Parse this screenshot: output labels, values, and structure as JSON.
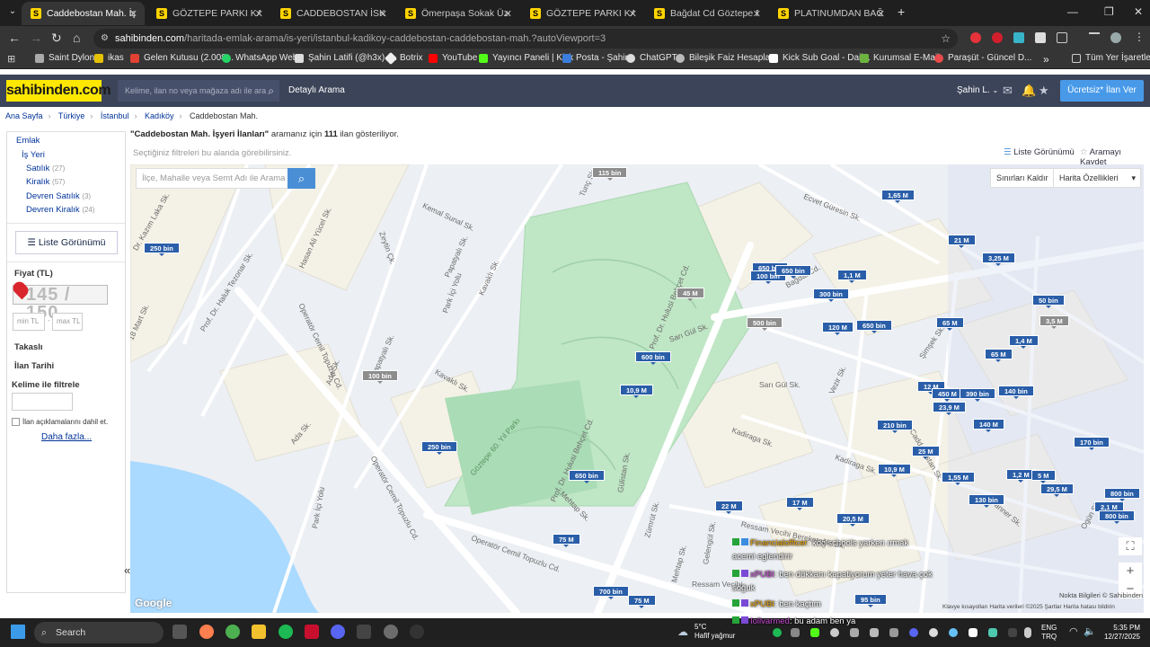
{
  "browser": {
    "tabs": [
      {
        "title": "Caddebostan Mah. İşyeri İl",
        "active": true
      },
      {
        "title": "GÖZTEPE PARKI KARŞISINI"
      },
      {
        "title": "CADDEBOSTAN İSKELE SOK"
      },
      {
        "title": "Ömerpaşa Sokak Üzerinde"
      },
      {
        "title": "GÖZTEPE PARKI KARŞISINI"
      },
      {
        "title": "Bağdat Cd Göztepe Parkı"
      },
      {
        "title": "PLATINUMDAN BAĞDAT C"
      }
    ],
    "url_host": "sahibinden.com",
    "url_path": "/haritada-emlak-arama/is-yeri/istanbul-kadikoy-caddebostan-caddebostan-mah.?autoViewport=3",
    "bookmarks": [
      "Saint Dylon",
      "ikas",
      "Gelen Kutusu (2.008...",
      "WhatsApp Web",
      "Şahin Latifi (@h3x) /...",
      "Botrix",
      "YouTube",
      "Yayıncı Paneli | Kick",
      "Posta - Şahin",
      "ChatGPT",
      "Bileşik Faiz Hesapla...",
      "Kick Sub Goal - Dail...",
      "Kurumsal E-Mail",
      "Paraşüt - Güncel D..."
    ],
    "all_bookmarks": "Tüm Yer İşaretleri"
  },
  "site": {
    "logo": "sahibinden.com",
    "search_placeholder": "Kelime, ilan no veya mağaza adı ile ara",
    "detailed_search": "Detaylı Arama",
    "user": "Şahin L.",
    "post_ad": "Ücretsiz* İlan Ver"
  },
  "breadcrumb": [
    "Ana Sayfa",
    "Türkiye",
    "İstanbul",
    "Kadıköy",
    "Caddebostan Mah."
  ],
  "results": {
    "query": "\"Caddebostan Mah. İşyeri İlanları\"",
    "middle": " aramanız için ",
    "count": "111",
    "suffix": " ilan gösteriliyor.",
    "filter_hint": "Seçtiğiniz filtreleri bu alanda görebilirsiniz.",
    "list_view": "Liste Görünümü",
    "save_search": "Aramayı Kaydet"
  },
  "sidebar": {
    "category": "Emlak",
    "subcategory": "İş Yeri",
    "items": [
      {
        "label": "Satılık",
        "count": "(27)"
      },
      {
        "label": "Kiralık",
        "count": "(57)"
      },
      {
        "label": "Devren Satılık",
        "count": "(3)"
      },
      {
        "label": "Devren Kiralık",
        "count": "(24)"
      }
    ],
    "list_view_button": "Liste Görünümü",
    "price_label": "Fiyat (TL)",
    "price_overlay": "145 / 150",
    "min_placeholder": "min TL",
    "max_placeholder": "max TL",
    "swap": "Takaslı",
    "date": "İlan Tarihi",
    "keyword": "Kelime ile filtrele",
    "include_desc": "İlan açıklamalarını dahil et.",
    "more": "Daha fazla..."
  },
  "map": {
    "search_placeholder": "İlçe, Mahalle veya Semt Adı ile Arama",
    "remove_bounds": "Sınırları Kaldır",
    "map_features": "Harita Özellikleri",
    "markers": [
      {
        "label": "115 bin",
        "gray": true
      },
      {
        "label": "250 bin"
      },
      {
        "label": "1,65 M"
      },
      {
        "label": "21 M"
      },
      {
        "label": "3,25 M"
      },
      {
        "label": "650 bin"
      },
      {
        "label": "100 bin"
      },
      {
        "label": "650 bin"
      },
      {
        "label": "1,1 M"
      },
      {
        "label": "45 M",
        "gray": true
      },
      {
        "label": "300 bin"
      },
      {
        "label": "50 bin"
      },
      {
        "label": "500 bin",
        "gray": true
      },
      {
        "label": "120 M"
      },
      {
        "label": "650 bin"
      },
      {
        "label": "65 M"
      },
      {
        "label": "3,5 M",
        "gray": true
      },
      {
        "label": "100 bin",
        "gray": true
      },
      {
        "label": "600 bin"
      },
      {
        "label": "1,4 M"
      },
      {
        "label": "65 M"
      },
      {
        "label": "10,9 M"
      },
      {
        "label": "12 M"
      },
      {
        "label": "450 M"
      },
      {
        "label": "390 bin"
      },
      {
        "label": "140 bin"
      },
      {
        "label": "23,9 M"
      },
      {
        "label": "210 bin"
      },
      {
        "label": "140 M"
      },
      {
        "label": "170 bin"
      },
      {
        "label": "250 bin"
      },
      {
        "label": "25 M"
      },
      {
        "label": "650 bin"
      },
      {
        "label": "10,9 M"
      },
      {
        "label": "1,55 M"
      },
      {
        "label": "1,2 M"
      },
      {
        "label": "5 M"
      },
      {
        "label": "29,5 M"
      },
      {
        "label": "130 bin"
      },
      {
        "label": "800 bin"
      },
      {
        "label": "22 M"
      },
      {
        "label": "17 M"
      },
      {
        "label": "20,5 M"
      },
      {
        "label": "2,1 M"
      },
      {
        "label": "800 bin"
      },
      {
        "label": "75 M"
      },
      {
        "label": "700 bin"
      },
      {
        "label": "75 M"
      },
      {
        "label": "95 bin"
      }
    ],
    "streets": [
      "Kemal Sunal Sk.",
      "Hasan Ali Yücel Sk.",
      "Ecvet Güresin Sk.",
      "Tunç Sk.",
      "Papatyalı Sk.",
      "Zeytin Çk.",
      "Kavaklı Sk.",
      "Prof. Dr. Haluk Tezonar Sk.",
      "18 Mart Sk.",
      "Dr. Kazım Laka Sk.",
      "Operatör Cemil Topuzlu Cd.",
      "Papatyalı Sk.",
      "Kavaklı Sk.",
      "Prof. Dr. Hulusi Behçet Cd.",
      "Sarı Gül Sk.",
      "Bağdat Cd.",
      "Vezir Sk.",
      "Şimşek Sk.",
      "Ada Sk.",
      "Sarı Gül Sk.",
      "Kadiraga Sk.",
      "Kadiraga Sk.",
      "Caddebostan Sk.",
      "Operatör Cemil Topuzlu Cd.",
      "Prof. Dr. Hulusi Behçet Cd.",
      "Mehtap Sk.",
      "Gülistan Sk.",
      "Zümrüt Sk.",
      "Ressam Vecihi Bereketoğlu Sk.",
      "Park İçi Yolu",
      "Operatör Cemil Topuzlu Cd.",
      "Mehtap Sk.",
      "Tanner Sk.",
      "Ogün Sk.",
      "Göztepe 60. Yıl Parkı",
      "Park İçi Yolu",
      "Ada Sk.",
      "Ressam Vecihi",
      "Gelengül Sk."
    ],
    "zoom_in": "+",
    "zoom_out": "−",
    "google": "Google",
    "attribution": "Klavye kısayolları   Harita verileri ©2025   Şartlar   Harita hatası bildirin",
    "nokta": "Nokta Bilgileri © Sahibinden"
  },
  "chat_overlay": [
    {
      "user": "Financialofficer",
      "text": ": koç schools yarken ırmak",
      "text2": "acemi eglendirir"
    },
    {
      "user": "xPUBI",
      "text": ": ben dükkanı kapatiyorum yeter hava çok",
      "text2": "soğuk"
    },
    {
      "user": "xPUBI",
      "text": ": ben kaçtım"
    },
    {
      "user": "Iollvarmed",
      "text": ": bu adam ben ya"
    }
  ],
  "taskbar": {
    "search": "Search",
    "weather_temp": "5°C",
    "weather_desc": "Hafif yağmur",
    "lang": "ENG",
    "lang2": "TRQ",
    "time": "5:35 PM",
    "date": "12/27/2025"
  }
}
